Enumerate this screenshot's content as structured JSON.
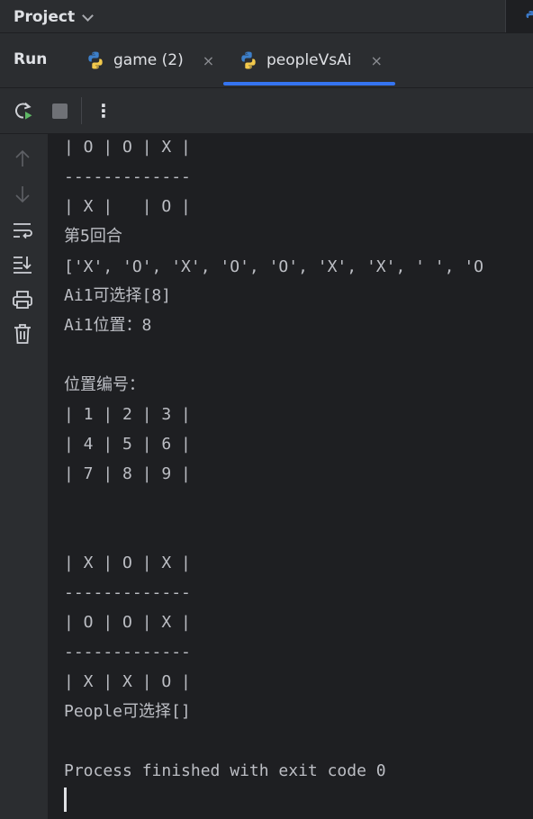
{
  "project": {
    "title": "Project"
  },
  "run": {
    "label": "Run",
    "tabs": [
      {
        "label": "game (2)",
        "active": false
      },
      {
        "label": "peopleVsAi",
        "active": true
      }
    ],
    "close_glyph": "×"
  },
  "toolbar": {
    "more_glyph": "⋮"
  },
  "console": {
    "lines": [
      "| O | O | X |",
      "-------------",
      "| X |   | O |",
      "第5回合",
      "['X', 'O', 'X', 'O', 'O', 'X', 'X', ' ', 'O",
      "Ai1可选择[8]",
      "Ai1位置：8",
      "",
      "位置编号：",
      "| 1 | 2 | 3 |",
      "| 4 | 5 | 6 |",
      "| 7 | 8 | 9 |",
      "",
      "",
      "| X | O | X |",
      "-------------",
      "| O | O | X |",
      "-------------",
      "| X | X | O |",
      "People可选择[]",
      "",
      "Process finished with exit code 0"
    ]
  },
  "colors": {
    "background": "#1e1f22",
    "panel": "#2b2d30",
    "text": "#dfe1e5",
    "console_text": "#bcbec4",
    "accent": "#3574f0",
    "run_green": "#5fb865"
  },
  "icons": {
    "project_chevron": "chevron-down-icon",
    "tab_icon": "python-icon",
    "rerun": "rerun-icon",
    "stop": "stop-icon",
    "more": "more-vertical-icon",
    "up": "arrow-up-icon",
    "down": "arrow-down-icon",
    "wrap": "soft-wrap-icon",
    "scroll_end": "scroll-to-end-icon",
    "print": "print-icon",
    "trash": "trash-icon"
  }
}
